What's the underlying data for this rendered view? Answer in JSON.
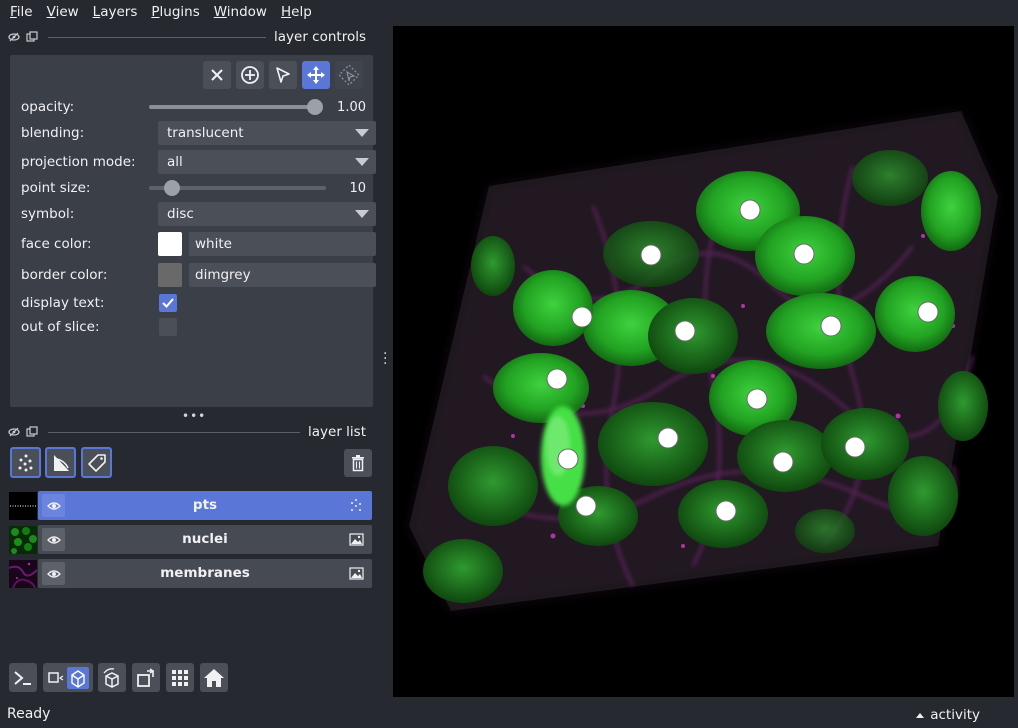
{
  "menu": [
    {
      "label": "File",
      "mnemonic_index": 0
    },
    {
      "label": "View",
      "mnemonic_index": 0
    },
    {
      "label": "Layers",
      "mnemonic_index": 0
    },
    {
      "label": "Plugins",
      "mnemonic_index": 0
    },
    {
      "label": "Window",
      "mnemonic_index": 0
    },
    {
      "label": "Help",
      "mnemonic_index": 0
    }
  ],
  "layer_controls": {
    "title": "layer controls",
    "tools": [
      "close-icon",
      "add-point-icon",
      "select-arrow-icon",
      "pan-zoom-icon",
      "transform-icon"
    ],
    "active_tool": "pan-zoom-icon",
    "opacity": {
      "label": "opacity:",
      "value": "1.00",
      "fraction": 1.0
    },
    "blending": {
      "label": "blending:",
      "value": "translucent"
    },
    "projection_mode": {
      "label": "projection mode:",
      "value": "all"
    },
    "point_size": {
      "label": "point size:",
      "value": "10",
      "fraction": 0.15
    },
    "symbol": {
      "label": "symbol:",
      "value": "disc"
    },
    "face_color": {
      "label": "face color:",
      "value": "white",
      "swatch": "#ffffff"
    },
    "border_color": {
      "label": "border color:",
      "value": "dimgrey",
      "swatch": "#696969"
    },
    "display_text": {
      "label": "display text:",
      "checked": true
    },
    "out_of_slice": {
      "label": "out of slice:",
      "checked": false
    }
  },
  "layer_list": {
    "title": "layer list",
    "layers": [
      {
        "name": "pts",
        "type": "points",
        "selected": true
      },
      {
        "name": "nuclei",
        "type": "image",
        "selected": false
      },
      {
        "name": "membranes",
        "type": "image",
        "selected": false
      }
    ]
  },
  "viewer_buttons": [
    "console-icon",
    "ndisplay-3d-icon",
    "roll-dims-icon",
    "transpose-icon",
    "grid-icon",
    "home-icon"
  ],
  "status": {
    "text": "Ready",
    "activity": "activity"
  },
  "colors": {
    "accent": "#5a76d6",
    "panel": "#3a3f48",
    "background": "#262930",
    "nuclei": "#1fa51f",
    "membranes": "#c032c0"
  }
}
